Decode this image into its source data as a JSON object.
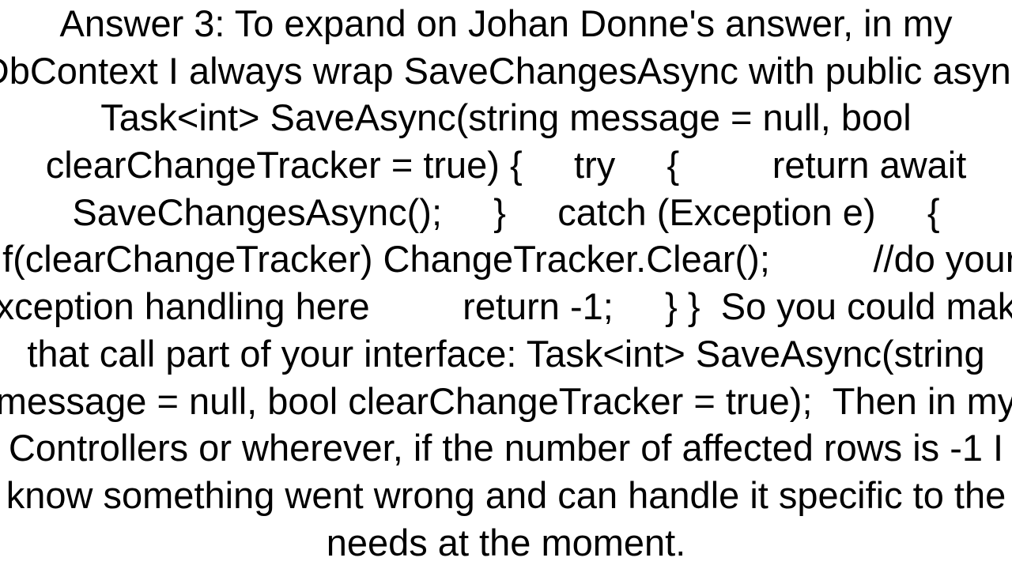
{
  "answer": {
    "label": "Answer 3:",
    "body": "To expand on Johan Donne's answer, in my DbContext I always wrap SaveChangesAsync with public async Task<int> SaveAsync(string message = null, bool clearChangeTracker = true) {     try     {         return await SaveChangesAsync();     }     catch (Exception e)     {         if(clearChangeTracker) ChangeTracker.Clear();          //do your exception handling here         return -1;     } }  So you could make that call part of your interface: Task<int> SaveAsync(string message = null, bool clearChangeTracker = true);  Then in my Controllers or wherever, if the number of affected rows is -1 I know something went wrong and can handle it specific to the needs at the moment."
  }
}
